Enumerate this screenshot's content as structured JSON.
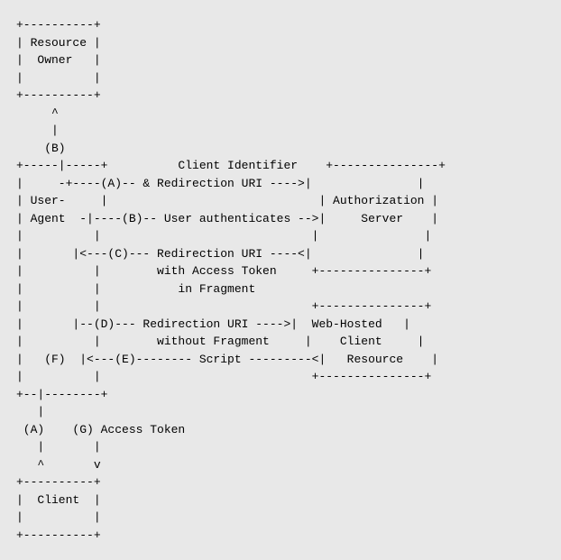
{
  "diagram": {
    "lines": [
      "+----------+",
      "| Resource |",
      "|  Owner   |",
      "|          |",
      "+----------+",
      "     ^",
      "     |",
      "    (B)",
      "+-----|-----+          Client Identifier    +---------------+",
      "|     -+----(A)-- & Redirection URI ---->|               |",
      "| User-     |                              | Authorization |",
      "| Agent  -|----(B)-- User authenticates -->|     Server    |",
      "|          |                              |               |",
      "|       |<---(C)--- Redirection URI ----<|               |",
      "|          |        with Access Token     +---------------+",
      "|          |           in Fragment",
      "|          |                              +---------------+",
      "|       |--(D)--- Redirection URI ---->|  Web-Hosted   |",
      "|          |        without Fragment     |    Client     |",
      "|   (F)  |<---(E)-------- Script ---------<|   Resource    |",
      "|          |                              |               |",
      "+--|--------+                              +---------------+",
      "   |",
      " (A)    (G) Access Token",
      "   |       |",
      "   ^       v",
      "+----------+",
      "|  Client  |",
      "|          |",
      "+----------+"
    ]
  }
}
